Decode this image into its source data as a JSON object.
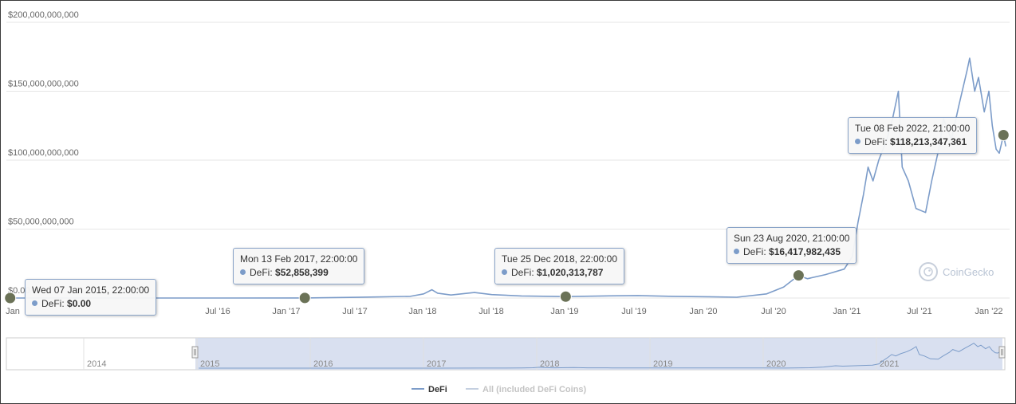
{
  "chart_data": {
    "type": "line",
    "y_ticks": [
      "$200,000,000,000",
      "$150,000,000,000",
      "$100,000,000,000",
      "$50,000,000,000",
      "$0.00"
    ],
    "ylim": [
      0,
      200000000000
    ],
    "x_ticks": [
      "Jan",
      "Jul '16",
      "Jan '17",
      "Jul '17",
      "Jan '18",
      "Jul '18",
      "Jan '19",
      "Jul '19",
      "Jan '20",
      "Jul '20",
      "Jan '21",
      "Jul '21",
      "Jan '22"
    ],
    "navigator_labels": [
      "2014",
      "2015",
      "2016",
      "2017",
      "2018",
      "2019",
      "2020",
      "2021"
    ],
    "legend": [
      {
        "label": "DeFi",
        "color": "#7c9cc9",
        "active": true
      },
      {
        "label": "All (included DeFi Coins)",
        "color": "#c4cfe0",
        "active": false
      }
    ],
    "grid": true,
    "watermark": "CoinGecko",
    "series": [
      {
        "name": "DeFi",
        "color": "#7c9cc9",
        "points": [
          [
            "2015-01-07",
            0
          ],
          [
            "2016-01-01",
            0
          ],
          [
            "2016-07-01",
            0
          ],
          [
            "2017-02-13",
            52858399
          ],
          [
            "2017-07-01",
            500000000
          ],
          [
            "2017-11-15",
            1200000000
          ],
          [
            "2017-12-20",
            3000000000
          ],
          [
            "2018-01-10",
            6000000000
          ],
          [
            "2018-01-25",
            3500000000
          ],
          [
            "2018-03-01",
            2200000000
          ],
          [
            "2018-05-01",
            4000000000
          ],
          [
            "2018-06-15",
            2500000000
          ],
          [
            "2018-09-01",
            1500000000
          ],
          [
            "2018-12-25",
            1020313787
          ],
          [
            "2019-04-01",
            1500000000
          ],
          [
            "2019-07-01",
            1800000000
          ],
          [
            "2019-10-01",
            1200000000
          ],
          [
            "2020-01-01",
            900000000
          ],
          [
            "2020-03-15",
            600000000
          ],
          [
            "2020-06-01",
            3000000000
          ],
          [
            "2020-07-15",
            8000000000
          ],
          [
            "2020-08-23",
            16417982435
          ],
          [
            "2020-09-15",
            14000000000
          ],
          [
            "2020-11-01",
            17000000000
          ],
          [
            "2020-12-20",
            21000000000
          ],
          [
            "2021-01-10",
            30000000000
          ],
          [
            "2021-01-25",
            55000000000
          ],
          [
            "2021-02-08",
            75000000000
          ],
          [
            "2021-02-20",
            95000000000
          ],
          [
            "2021-03-05",
            85000000000
          ],
          [
            "2021-03-20",
            100000000000
          ],
          [
            "2021-04-10",
            115000000000
          ],
          [
            "2021-04-25",
            130000000000
          ],
          [
            "2021-05-10",
            150000000000
          ],
          [
            "2021-05-20",
            95000000000
          ],
          [
            "2021-06-05",
            85000000000
          ],
          [
            "2021-06-25",
            65000000000
          ],
          [
            "2021-07-20",
            62000000000
          ],
          [
            "2021-08-05",
            85000000000
          ],
          [
            "2021-08-25",
            110000000000
          ],
          [
            "2021-09-05",
            130000000000
          ],
          [
            "2021-09-25",
            115000000000
          ],
          [
            "2021-10-15",
            140000000000
          ],
          [
            "2021-11-05",
            165000000000
          ],
          [
            "2021-11-12",
            174000000000
          ],
          [
            "2021-11-25",
            150000000000
          ],
          [
            "2021-12-05",
            160000000000
          ],
          [
            "2021-12-20",
            135000000000
          ],
          [
            "2022-01-01",
            150000000000
          ],
          [
            "2022-01-10",
            125000000000
          ],
          [
            "2022-01-20",
            108000000000
          ],
          [
            "2022-01-28",
            105000000000
          ],
          [
            "2022-02-08",
            118213347361
          ],
          [
            "2022-02-14",
            110000000000
          ]
        ]
      }
    ],
    "tooltips": [
      {
        "date": "Wed 07 Jan 2015, 22:00:00",
        "label": "DeFi:",
        "value": "$0.00",
        "x": "2015-01-07",
        "y": 0
      },
      {
        "date": "Mon 13 Feb 2017, 22:00:00",
        "label": "DeFi:",
        "value": "$52,858,399",
        "x": "2017-02-13",
        "y": 52858399
      },
      {
        "date": "Tue 25 Dec 2018, 22:00:00",
        "label": "DeFi:",
        "value": "$1,020,313,787",
        "x": "2018-12-25",
        "y": 1020313787
      },
      {
        "date": "Sun 23 Aug 2020, 21:00:00",
        "label": "DeFi:",
        "value": "$16,417,982,435",
        "x": "2020-08-23",
        "y": 16417982435
      },
      {
        "date": "Tue 08 Feb 2022, 21:00:00",
        "label": "DeFi:",
        "value": "$118,213,347,361",
        "x": "2022-02-08",
        "y": 118213347361
      }
    ]
  }
}
